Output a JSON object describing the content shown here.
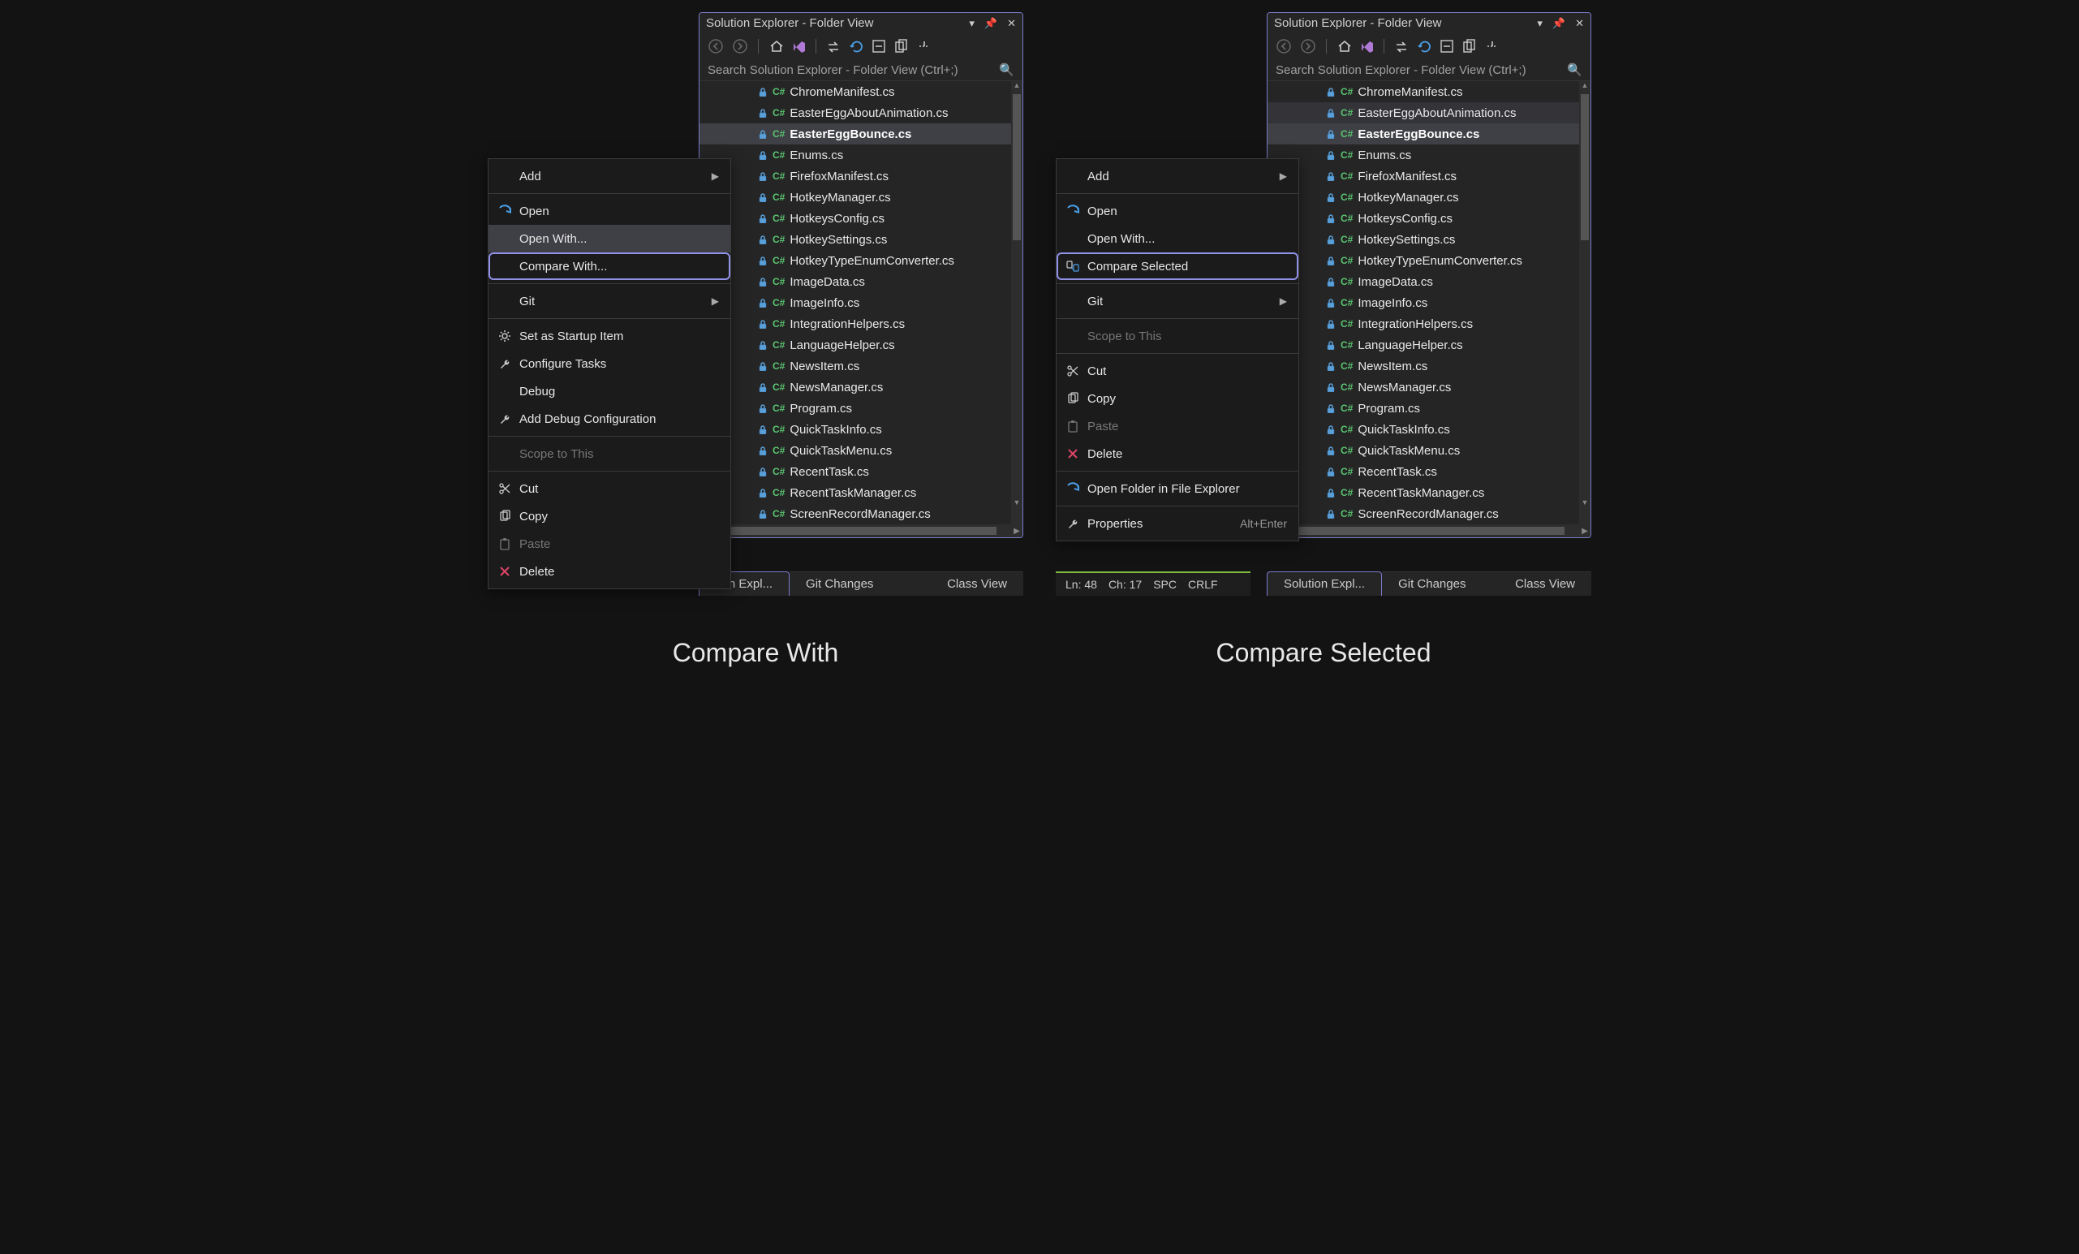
{
  "panel": {
    "title": "Solution Explorer - Folder View",
    "search_placeholder": "Search Solution Explorer - Folder View (Ctrl+;)",
    "files": [
      "ChromeManifest.cs",
      "EasterEggAboutAnimation.cs",
      "EasterEggBounce.cs",
      "Enums.cs",
      "FirefoxManifest.cs",
      "HotkeyManager.cs",
      "HotkeysConfig.cs",
      "HotkeySettings.cs",
      "HotkeyTypeEnumConverter.cs",
      "ImageData.cs",
      "ImageInfo.cs",
      "IntegrationHelpers.cs",
      "LanguageHelper.cs",
      "NewsItem.cs",
      "NewsManager.cs",
      "Program.cs",
      "QuickTaskInfo.cs",
      "QuickTaskMenu.cs",
      "RecentTask.cs",
      "RecentTaskManager.cs",
      "ScreenRecordManager.cs"
    ]
  },
  "tabs": {
    "explorer_short": "tion Expl...",
    "explorer_full": "Solution Expl...",
    "git": "Git Changes",
    "classview": "Class View"
  },
  "status": {
    "ln": "Ln: 48",
    "ch": "Ch: 17",
    "spc": "SPC",
    "crlf": "CRLF"
  },
  "left_menu": {
    "add": "Add",
    "open": "Open",
    "open_with": "Open With...",
    "compare_with": "Compare With...",
    "git": "Git",
    "set_startup": "Set as Startup Item",
    "configure_tasks": "Configure Tasks",
    "debug": "Debug",
    "add_debug": "Add Debug Configuration",
    "scope": "Scope to This",
    "cut": "Cut",
    "copy": "Copy",
    "paste": "Paste",
    "delete": "Delete"
  },
  "right_menu": {
    "add": "Add",
    "open": "Open",
    "open_with": "Open With...",
    "compare_selected": "Compare Selected",
    "git": "Git",
    "scope": "Scope to This",
    "cut": "Cut",
    "copy": "Copy",
    "paste": "Paste",
    "delete": "Delete",
    "open_folder": "Open Folder in File Explorer",
    "properties": "Properties",
    "properties_accel": "Alt+Enter"
  },
  "captions": {
    "left": "Compare With",
    "right": "Compare Selected"
  }
}
